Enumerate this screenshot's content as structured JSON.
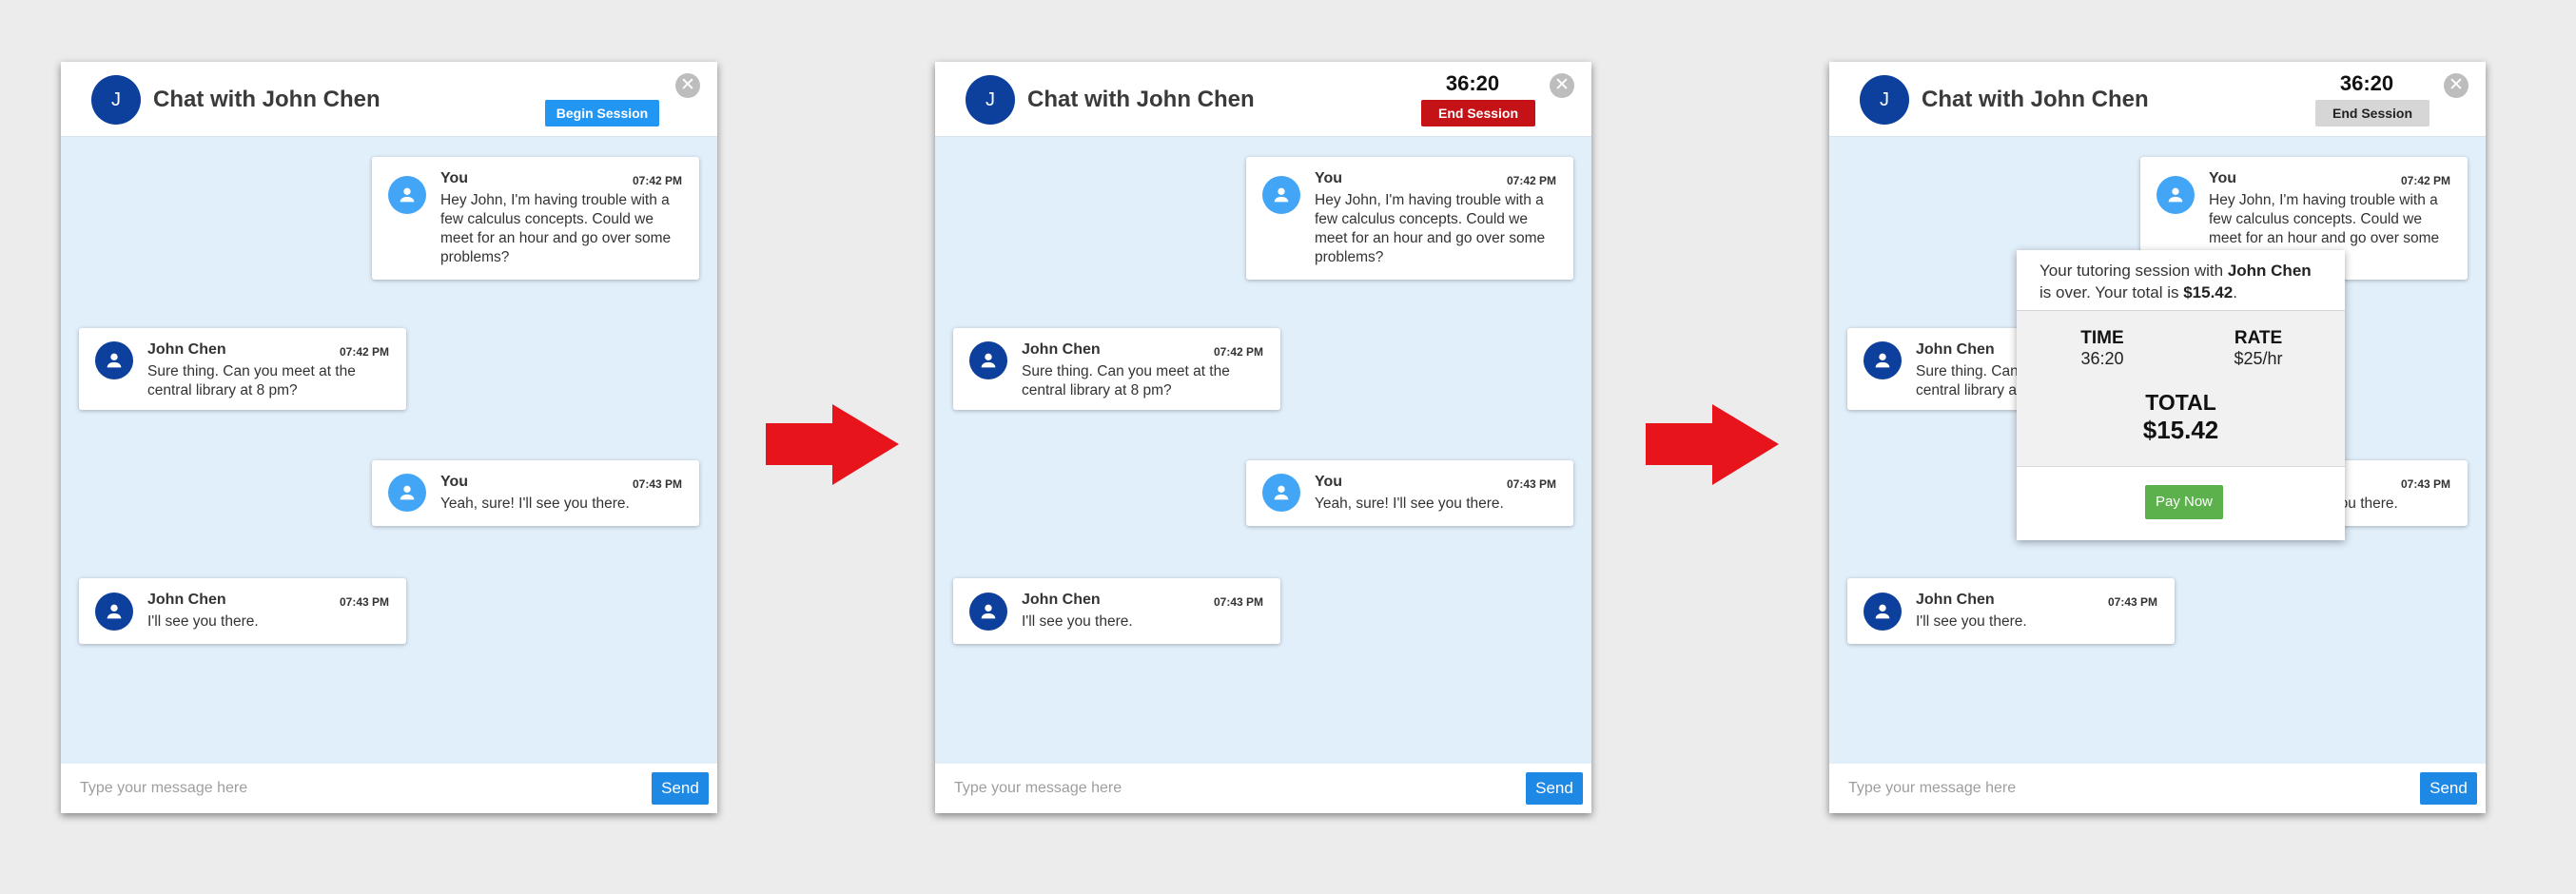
{
  "chat": {
    "title": "Chat with John Chen",
    "avatar_initial": "J",
    "close_symbol": "✕",
    "input_placeholder": "Type your message here",
    "send_label": "Send"
  },
  "messages": [
    {
      "sender": "You",
      "time": "07:42 PM",
      "text": "Hey John, I'm having trouble with a few calculus concepts. Could we meet for an hour and go over some problems?"
    },
    {
      "sender": "John Chen",
      "time": "07:42 PM",
      "text": "Sure thing. Can you meet at the central library at 8 pm?"
    },
    {
      "sender": "You",
      "time": "07:43 PM",
      "text": "Yeah, sure! I'll see you there."
    },
    {
      "sender": "John Chen",
      "time": "07:43 PM",
      "text": "I'll see you there."
    }
  ],
  "states": [
    {
      "button_label": "Begin Session",
      "button_color": "#2196f3",
      "timer": ""
    },
    {
      "button_label": "End Session",
      "button_color": "#c41216",
      "timer": "36:20"
    },
    {
      "button_label": "End Session",
      "button_color": "#d6d6d6",
      "timer": "36:20"
    }
  ],
  "summary": {
    "intro": "Your tutoring session with ",
    "tutor": "John Chen",
    "middle": " is over. Your total is ",
    "total_inline": "$15.42",
    "end": ".",
    "time_label": "TIME",
    "time_value": "36:20",
    "rate_label": "RATE",
    "rate_value": "$25/hr",
    "total_label": "TOTAL",
    "total_value": "$15.42",
    "pay_label": "Pay Now",
    "pay_color": "#5cb14c"
  },
  "colors": {
    "chat_background": "#e1effb",
    "you_avatar": "#42a5f5",
    "john_avatar": "#0d3f9c",
    "arrow": "#e8141c",
    "send_button": "#1e88e5"
  },
  "icons": {
    "avatar": "person-icon",
    "flow_arrow": "right-arrow-icon",
    "close": "close-icon"
  }
}
